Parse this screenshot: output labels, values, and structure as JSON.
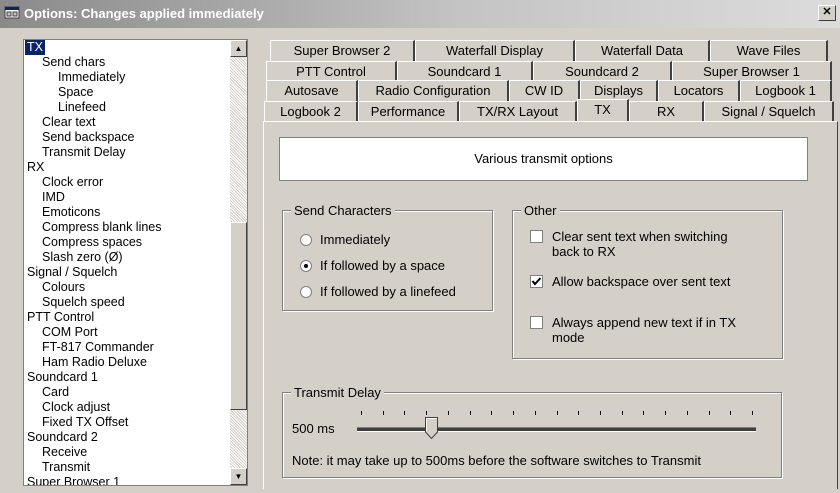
{
  "window": {
    "title": "Options: Changes applied immediately",
    "close_label": "✕"
  },
  "tree": {
    "items": [
      {
        "label": "TX",
        "level": 0,
        "selected": true
      },
      {
        "label": "Send chars",
        "level": 1
      },
      {
        "label": "Immediately",
        "level": 2
      },
      {
        "label": "Space",
        "level": 2
      },
      {
        "label": "Linefeed",
        "level": 2
      },
      {
        "label": "Clear text",
        "level": 1
      },
      {
        "label": "Send backspace",
        "level": 1
      },
      {
        "label": "Transmit Delay",
        "level": 1
      },
      {
        "label": "RX",
        "level": 0
      },
      {
        "label": "Clock error",
        "level": 1
      },
      {
        "label": "IMD",
        "level": 1
      },
      {
        "label": "Emoticons",
        "level": 1
      },
      {
        "label": "Compress blank lines",
        "level": 1
      },
      {
        "label": "Compress spaces",
        "level": 1
      },
      {
        "label": "Slash zero (Ø)",
        "level": 1
      },
      {
        "label": "Signal / Squelch",
        "level": 0
      },
      {
        "label": "Colours",
        "level": 1
      },
      {
        "label": "Squelch speed",
        "level": 1
      },
      {
        "label": "PTT Control",
        "level": 0
      },
      {
        "label": "COM Port",
        "level": 1
      },
      {
        "label": "FT-817 Commander",
        "level": 1
      },
      {
        "label": "Ham Radio Deluxe",
        "level": 1
      },
      {
        "label": "Soundcard 1",
        "level": 0
      },
      {
        "label": "Card",
        "level": 1
      },
      {
        "label": "Clock adjust",
        "level": 1
      },
      {
        "label": "Fixed TX Offset",
        "level": 1
      },
      {
        "label": "Soundcard 2",
        "level": 0
      },
      {
        "label": "Receive",
        "level": 1
      },
      {
        "label": "Transmit",
        "level": 1
      },
      {
        "label": "Super Browser 1",
        "level": 0
      }
    ]
  },
  "tabs": {
    "row1": [
      "Super Browser 2",
      "Waterfall Display",
      "Waterfall Data",
      "Wave Files"
    ],
    "row2": [
      "PTT Control",
      "Soundcard 1",
      "Soundcard 2",
      "Super Browser 1"
    ],
    "row3": [
      "Autosave",
      "Radio Configuration",
      "CW ID",
      "Displays",
      "Locators",
      "Logbook 1"
    ],
    "row4": [
      "Logbook 2",
      "Performance",
      "TX/RX Layout",
      "TX",
      "RX",
      "Signal / Squelch"
    ],
    "active": "TX"
  },
  "header": {
    "text": "Various transmit options"
  },
  "send_characters": {
    "title": "Send Characters",
    "options": [
      "Immediately",
      "If followed by a space",
      "If followed by a linefeed"
    ],
    "selected_index": 1
  },
  "other": {
    "title": "Other",
    "clear_sent": {
      "label_line1": "Clear sent text when switching",
      "label_line2": "back to RX",
      "checked": false
    },
    "allow_backspace": {
      "label": "Allow backspace over sent text",
      "checked": true
    },
    "always_append": {
      "label_line1": "Always append new text if in TX",
      "label_line2": "mode",
      "checked": false
    }
  },
  "transmit_delay": {
    "title": "Transmit Delay",
    "value_label": "500 ms",
    "slider_fraction": 0.18,
    "note": "Note: it may take up to 500ms before the software switches to Transmit"
  }
}
